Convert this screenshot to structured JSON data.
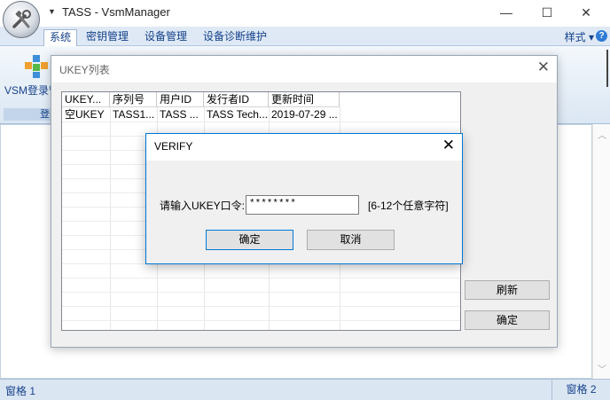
{
  "window": {
    "title": "TASS - VsmManager",
    "minimize": "—",
    "maximize": "☐",
    "close": "✕"
  },
  "ribbon": {
    "tabs": [
      {
        "label": "系统",
        "active": true
      },
      {
        "label": "密钥管理",
        "active": false
      },
      {
        "label": "设备管理",
        "active": false
      },
      {
        "label": "设备诊断维护",
        "active": false
      }
    ],
    "style_menu": "样式 ▾",
    "help": "?",
    "vsm_button": "VSM登录管",
    "group_label": "登"
  },
  "ukey_dialog": {
    "title": "UKEY列表",
    "close": "✕",
    "columns": [
      "UKEY...",
      "序列号",
      "用户ID",
      "发行者ID",
      "更新时间"
    ],
    "rows": [
      [
        "空UKEY",
        "TASS1...",
        "TASS ...",
        "TASS Tech...",
        "2019-07-29 ..."
      ]
    ],
    "refresh_button": "刷新",
    "ok_button": "确定"
  },
  "verify_dialog": {
    "title": "VERIFY",
    "close": "✕",
    "prompt_label": "请输入UKEY口令:",
    "password_value": "********",
    "hint": "[6-12个任意字符]",
    "ok_button": "确定",
    "cancel_button": "取消"
  },
  "statusbar": {
    "pane1": "窗格 1",
    "pane2": "窗格 2"
  },
  "colors": {
    "accent": "#0078d7",
    "ribbon_text": "#15428b",
    "ribbon_bg": "#dfe9f5"
  }
}
